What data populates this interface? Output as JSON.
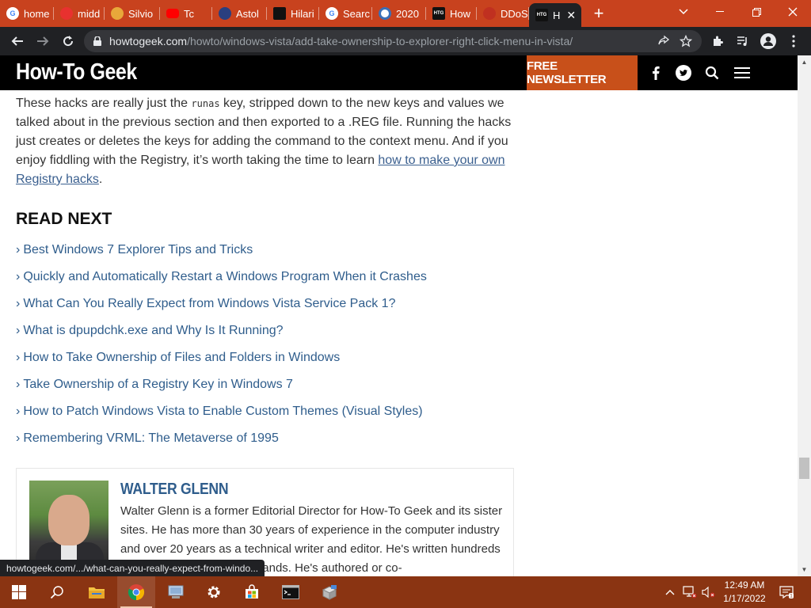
{
  "browser": {
    "tabs": [
      {
        "title": "home",
        "icon": "google-icon",
        "color": "#4285f4"
      },
      {
        "title": "midd",
        "icon": "red-swirl-icon",
        "color": "#e8312f"
      },
      {
        "title": "Silvio",
        "icon": "dollar-icon",
        "color": "#e8a83a"
      },
      {
        "title": "Tc",
        "icon": "youtube-icon",
        "color": "#ff0000"
      },
      {
        "title": "Astol",
        "icon": "ta-icon",
        "color": "#2a3f7f"
      },
      {
        "title": "Hilari",
        "icon": "brand-icon",
        "color": "#111111"
      },
      {
        "title": "Searc",
        "icon": "google-icon",
        "color": "#4285f4"
      },
      {
        "title": "2020",
        "icon": "globe-icon",
        "color": "#3b6fb6"
      },
      {
        "title": "How",
        "icon": "htg-icon",
        "color": "#111111"
      },
      {
        "title": "DDoS",
        "icon": "ddos-icon",
        "color": "#c03020"
      },
      {
        "title": "H",
        "icon": "htg-icon",
        "color": "#111111",
        "active": true
      }
    ],
    "new_tab": "+",
    "url_host": "howtogeek.com",
    "url_path": "/howto/windows-vista/add-take-ownership-to-explorer-right-click-menu-in-vista/",
    "accent": "#c8421e"
  },
  "site": {
    "logo": "How-To Geek",
    "newsletter": "FREE NEWSLETTER",
    "newsletter_color": "#c8501a"
  },
  "article": {
    "para_before_code": "These hacks are really just the ",
    "code": "runas",
    "para_after_code": " key, stripped down to the new keys and values we talked about in the previous section and then exported to a .REG file. Running the hacks just creates or deletes the keys for adding the command to the context menu. And if you enjoy fiddling with the Registry, it’s worth taking the time to learn ",
    "link": "how to make your own Registry hacks",
    "para_end": "."
  },
  "read_next": {
    "heading": "READ NEXT",
    "bullet": "›",
    "items": [
      "Best Windows 7 Explorer Tips and Tricks",
      "Quickly and Automatically Restart a Windows Program When it Crashes",
      "What Can You Really Expect from Windows Vista Service Pack 1?",
      "What is dpupdchk.exe and Why Is It Running?",
      "How to Take Ownership of Files and Folders in Windows",
      "Take Ownership of a Registry Key in Windows 7",
      "How to Patch Windows Vista to Enable Custom Themes (Visual Styles)",
      "Remembering VRML: The Metaverse of 1995"
    ]
  },
  "author": {
    "name": "WALTER GLENN",
    "bio": "Walter Glenn is a former Editorial Director for How-To Geek and its sister sites. He has more than 30 years of experience in the computer industry and over 20 years as a technical writer and editor. He's written hundreds of articles and edited thousands. He's authored or co-"
  },
  "status_url": "howtogeek.com/.../what-can-you-really-expect-from-windo...",
  "taskbar": {
    "clock_time": "12:49 AM",
    "clock_date": "1/17/2022",
    "accent": "#8a3412"
  }
}
